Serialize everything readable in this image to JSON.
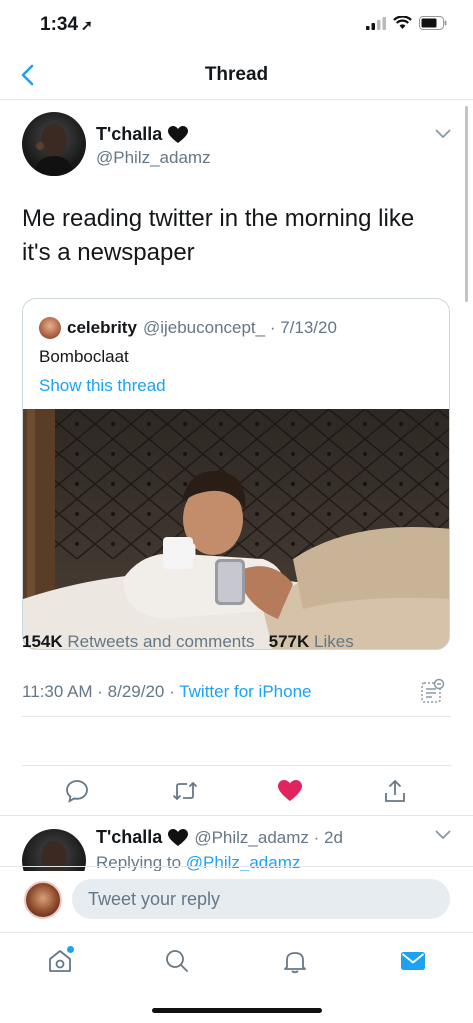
{
  "status_bar": {
    "time": "1:34",
    "location_arrow": "location-arrow-icon"
  },
  "nav": {
    "title": "Thread",
    "back_icon": "chevron-left-icon"
  },
  "tweet": {
    "author_name": "T'challa",
    "author_handle": "@Philz_adamz",
    "name_emoji": "black-heart-icon",
    "text": "Me reading twitter in the morning like it's a newspaper",
    "quote": {
      "name": "celebrity",
      "handle_date": "@ijebuconcept_ · 7/13/20",
      "text": "Bomboclaat",
      "link": "Show this thread"
    },
    "time_date": "11:30 AM · 8/29/20 · ",
    "source": "Twitter for iPhone",
    "retweets_count": "154K",
    "retweets_label": "Retweets and comments",
    "likes_count": "577K",
    "likes_label": "Likes",
    "liked_color": "#e0245e"
  },
  "reply": {
    "author_name": "T'challa",
    "handle_time": "@Philz_adamz · 2d",
    "replying_prefix": "Replying to ",
    "replying_to": "@Philz_adamz"
  },
  "compose": {
    "placeholder": "Tweet your reply"
  },
  "colors": {
    "accent": "#1da1f2",
    "secondary_text": "#657786",
    "divider": "#e1e8ed"
  }
}
